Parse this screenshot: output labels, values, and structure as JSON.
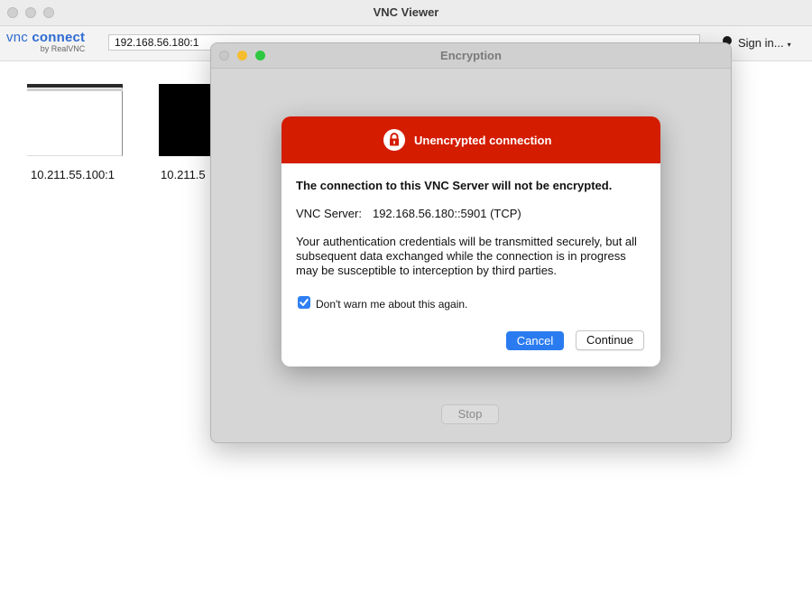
{
  "window": {
    "title": "VNC Viewer"
  },
  "toolbar": {
    "logo_main_a": "vnc",
    "logo_main_b": "connect",
    "logo_sub": "by RealVNC",
    "address_value": "192.168.56.180:1",
    "sign_in_label": "Sign in...",
    "sign_in_caret": "▾"
  },
  "address_book": [
    {
      "label": "10.211.55.100:1"
    },
    {
      "label": "10.211.5"
    }
  ],
  "encryption_window": {
    "title": "Encryption",
    "stop_label": "Stop"
  },
  "dialog": {
    "header_title": "Unencrypted connection",
    "header_color": "#d41c00",
    "bold_message": "The connection to this VNC Server will not be encrypted.",
    "server_label": "VNC Server:",
    "server_value": "192.168.56.180::5901 (TCP)",
    "paragraph": "Your authentication credentials will be transmitted securely, but all subsequent data exchanged while the connection is in progress may be susceptible to interception by third parties.",
    "checkbox_label": "Don't warn me about this again.",
    "checkbox_checked": true,
    "cancel_label": "Cancel",
    "continue_label": "Continue"
  },
  "icons": {
    "lock": "lock-icon",
    "person": "person-icon",
    "check": "checkmark-icon"
  }
}
